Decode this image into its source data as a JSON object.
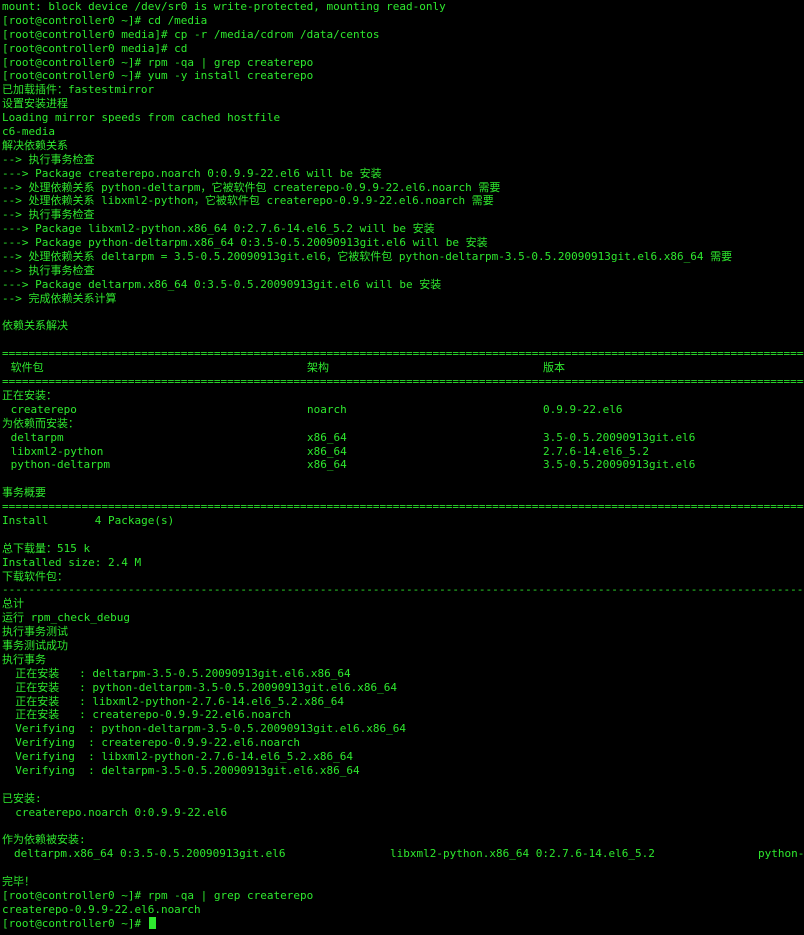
{
  "terminal": {
    "lines_top": [
      "mount: block device /dev/sr0 is write-protected, mounting read-only",
      "[root@controller0 ~]# cd /media",
      "[root@controller0 media]# cp -r /media/cdrom /data/centos",
      "[root@controller0 media]# cd",
      "[root@controller0 ~]# rpm -qa | grep createrepo",
      "[root@controller0 ~]# yum -y install createrepo",
      "已加载插件：fastestmirror",
      "设置安装进程",
      "Loading mirror speeds from cached hostfile",
      "c6-media",
      "解决依赖关系",
      "--> 执行事务检查",
      "---> Package createrepo.noarch 0:0.9.9-22.el6 will be 安装",
      "--> 处理依赖关系 python-deltarpm，它被软件包 createrepo-0.9.9-22.el6.noarch 需要",
      "--> 处理依赖关系 libxml2-python，它被软件包 createrepo-0.9.9-22.el6.noarch 需要",
      "--> 执行事务检查",
      "---> Package libxml2-python.x86_64 0:2.7.6-14.el6_5.2 will be 安装",
      "---> Package python-deltarpm.x86_64 0:3.5-0.5.20090913git.el6 will be 安装",
      "--> 处理依赖关系 deltarpm = 3.5-0.5.20090913git.el6，它被软件包 python-deltarpm-3.5-0.5.20090913git.el6.x86_64 需要",
      "--> 执行事务检查",
      "---> Package deltarpm.x86_64 0:3.5-0.5.20090913git.el6 will be 安装",
      "--> 完成依赖关系计算",
      "",
      "依赖关系解决",
      "",
      "===================================================================================================================================================="
    ],
    "table_header": {
      "package": " 软件包",
      "arch": "架构",
      "version": "版本"
    },
    "separator": "====================================================================================================================================================",
    "installing_label": "正在安装：",
    "installing": [
      {
        "name": " createrepo",
        "arch": "noarch",
        "version": "0.9.9-22.el6"
      }
    ],
    "deps_label": "为依赖而安装：",
    "deps": [
      {
        "name": " deltarpm",
        "arch": "x86_64",
        "version": "3.5-0.5.20090913git.el6"
      },
      {
        "name": " libxml2-python",
        "arch": "x86_64",
        "version": "2.7.6-14.el6_5.2"
      },
      {
        "name": " python-deltarpm",
        "arch": "x86_64",
        "version": "3.5-0.5.20090913git.el6"
      }
    ],
    "lines_summary": [
      "",
      "事务概要",
      "====================================================================================================================================================",
      "Install       4 Package(s)",
      "",
      "总下载量：515 k",
      "Installed size: 2.4 M",
      "下载软件包：",
      "----------------------------------------------------------------------------------------------------------------------------------------------------",
      "总计",
      "运行 rpm_check_debug",
      "执行事务测试",
      "事务测试成功",
      "执行事务",
      "  正在安装   : deltarpm-3.5-0.5.20090913git.el6.x86_64",
      "  正在安装   : python-deltarpm-3.5-0.5.20090913git.el6.x86_64",
      "  正在安装   : libxml2-python-2.7.6-14.el6_5.2.x86_64",
      "  正在安装   : createrepo-0.9.9-22.el6.noarch",
      "  Verifying  : python-deltarpm-3.5-0.5.20090913git.el6.x86_64",
      "  Verifying  : createrepo-0.9.9-22.el6.noarch",
      "  Verifying  : libxml2-python-2.7.6-14.el6_5.2.x86_64",
      "  Verifying  : deltarpm-3.5-0.5.20090913git.el6.x86_64",
      "",
      "已安装:",
      "  createrepo.noarch 0:0.9.9-22.el6",
      "",
      "作为依赖被安装:"
    ],
    "dep_installed": {
      "a": "deltarpm.x86_64 0:3.5-0.5.20090913git.el6",
      "b": "libxml2-python.x86_64 0:2.7.6-14.el6_5.2",
      "c": "python-"
    },
    "lines_end": [
      "",
      "完毕！",
      "[root@controller0 ~]# rpm -qa | grep createrepo",
      "createrepo-0.9.9-22.el6.noarch"
    ],
    "prompt": "[root@controller0 ~]# ",
    "colors": {
      "background": "#000000",
      "foreground": "#2ee82e"
    }
  }
}
